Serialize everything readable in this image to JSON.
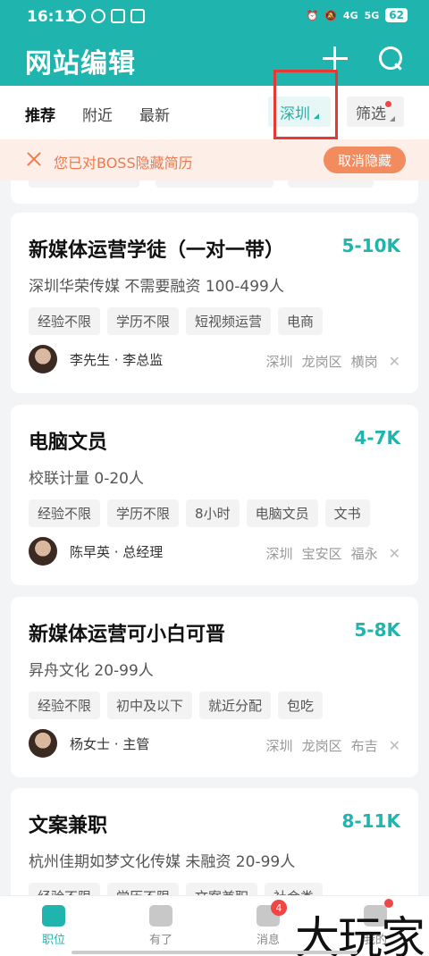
{
  "status": {
    "time": "16:11",
    "network1": "4G",
    "network2": "5G",
    "battery": "62"
  },
  "header": {
    "title": "网站编辑"
  },
  "filter": {
    "tabs": [
      "推荐",
      "附近",
      "最新"
    ],
    "city": "深圳",
    "filter_label": "筛选"
  },
  "notice": {
    "text": "您已对BOSS隐藏简历",
    "action": "取消隐藏"
  },
  "jobs": [
    {
      "title": "新媒体运营学徒（一对一带）",
      "salary": "5-10K",
      "company": "深圳华荣传媒  不需要融资  100-499人",
      "tags": [
        "经验不限",
        "学历不限",
        "短视频运营",
        "电商"
      ],
      "recruiter": "李先生 · 李总监",
      "location": [
        "深圳",
        "龙岗区",
        "横岗"
      ]
    },
    {
      "title": "电脑文员",
      "salary": "4-7K",
      "company": "校联计量  0-20人",
      "tags": [
        "经验不限",
        "学历不限",
        "8小时",
        "电脑文员",
        "文书"
      ],
      "recruiter": "陈早英 · 总经理",
      "location": [
        "深圳",
        "宝安区",
        "福永"
      ]
    },
    {
      "title": "新媒体运营可小白可晋",
      "salary": "5-8K",
      "company": "昇舟文化  20-99人",
      "tags": [
        "经验不限",
        "初中及以下",
        "就近分配",
        "包吃"
      ],
      "recruiter": "杨女士 · 主管",
      "location": [
        "深圳",
        "龙岗区",
        "布吉"
      ]
    },
    {
      "title": "文案兼职",
      "salary": "8-11K",
      "company": "杭州佳期如梦文化传媒  未融资  20-99人",
      "tags": [
        "经验不限",
        "学历不限",
        "文案兼职",
        "社会类"
      ],
      "recruiter": "",
      "location": []
    }
  ],
  "nav": {
    "items": [
      "职位",
      "有了",
      "消息",
      "我的"
    ],
    "message_badge": "4"
  },
  "watermark": "大玩家",
  "colors": {
    "accent": "#1fb5ae",
    "notice": "#ee7a4f",
    "highlight": "#e53935"
  }
}
